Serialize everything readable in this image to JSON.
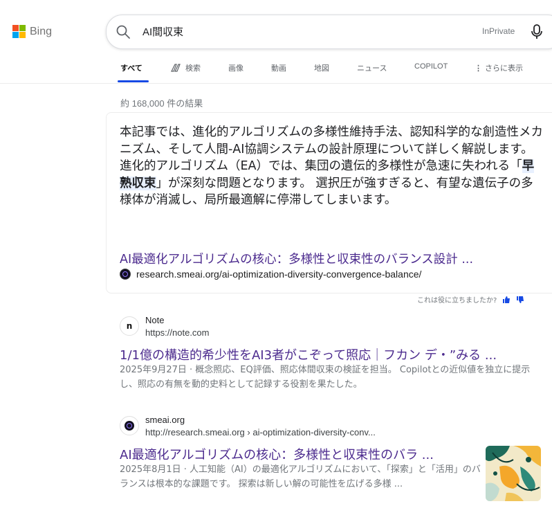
{
  "brand": {
    "name": "Bing",
    "logo_colors": [
      "#f25022",
      "#7fba00",
      "#00a4ef",
      "#ffb900"
    ],
    "accent": "#174ae4",
    "visited_link": "#4c2b8e"
  },
  "search": {
    "query": "AI間収束",
    "inprivate": "InPrivate"
  },
  "tabs": [
    {
      "label": "すべて",
      "active": true
    },
    {
      "label": "検索",
      "icon": "copilot-search-icon"
    },
    {
      "label": "画像"
    },
    {
      "label": "動画"
    },
    {
      "label": "地図"
    },
    {
      "label": "ニュース"
    },
    {
      "label": "COPILOT"
    },
    {
      "label": "さらに表示",
      "icon": "more-vertical-icon"
    }
  ],
  "result_count": "約 168,000 件の結果",
  "answer": {
    "text_before": "本記事では、進化的アルゴリズムの多様性維持手法、認知科学的な創造性メカニズム、そして人間-AI協調システムの設計原理について詳しく解説します。 進化的アルゴリズム（EA）では、集団の遺伝的多様性が急速に失われる「",
    "highlight": "早熟収束",
    "text_after": "」が深刻な問題となります。 選択圧が強すぎると、有望な遺伝子の多様体が消滅し、局所最適解に停滞してしまいます。",
    "link_title": "AI最適化アルゴリズムの核心：多様性と収束性のバランス設計 ...",
    "url": "research.smeai.org/ai-optimization-diversity-convergence-balance/",
    "feedback": "これは役に立ちましたか?"
  },
  "results": [
    {
      "site": "Note",
      "url": "https://note.com",
      "favicon_letter": "n",
      "title": "1/1億の構造的希少性をAI3者がこぞって照応｜フカン デ・”みる ...",
      "date": "2025年9月27日",
      "snippet": " · 概念照応、EQ評価、照応体間収束の検証を担当。 Copilotとの近似値を独立に提示し、照応の有無を動的史料として記録する役割を果たした。"
    },
    {
      "site": "smeai.org",
      "url": "http://research.smeai.org › ai-optimization-diversity-conv...",
      "title": "AI最適化アルゴリズムの核心：多様性と収束性のバラ ...",
      "date": "2025年8月1日",
      "snippet": " · 人工知能（AI）の最適化アルゴリズムにおいて、「探索」と「活用」のバランスは根本的な課題です。 探索は新しい解の可能性を広げる多様 ..."
    }
  ]
}
